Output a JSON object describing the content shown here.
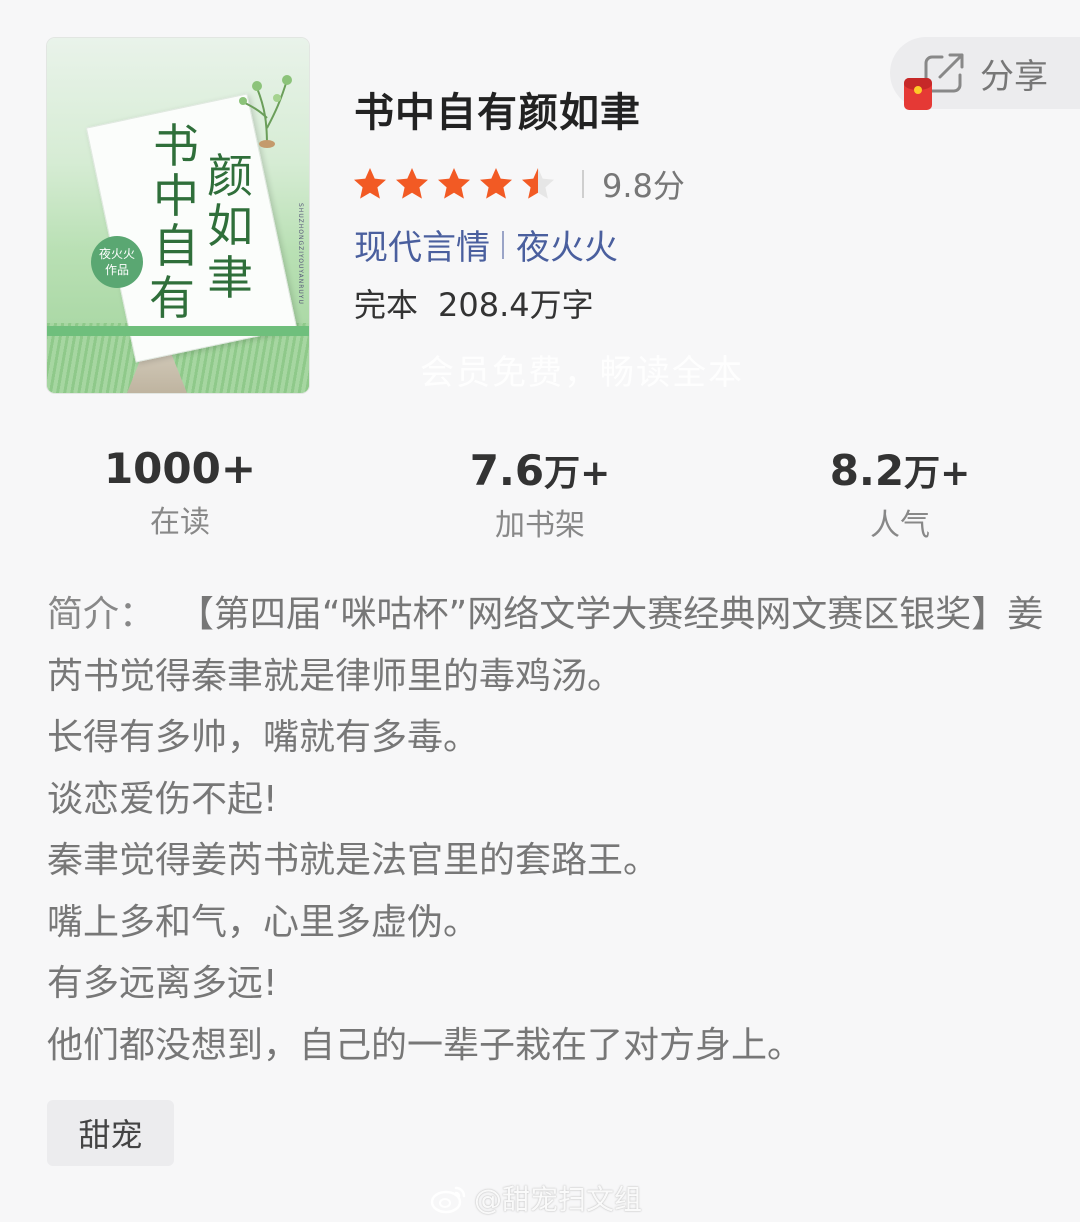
{
  "book": {
    "title": "书中自有颜如聿",
    "score": "9.8分",
    "rating": 4.5,
    "rating_max": 5,
    "genre": "现代言情",
    "author": "夜火火",
    "status": "完本",
    "word_count": "208.4万字",
    "overlay_text": "会员免费，畅读全本"
  },
  "cover": {
    "title_chars": [
      "书",
      "中",
      "自",
      "有",
      "颜",
      "如",
      "聿"
    ],
    "seal_line1": "夜火火",
    "seal_line2": "作品",
    "pinyin": "SHUZHONGZIYOUYANRUYU"
  },
  "share": {
    "label": "分享"
  },
  "stats": [
    {
      "value": "1000+",
      "unit": "",
      "label": "在读"
    },
    {
      "value": "7.6",
      "unit": "万+",
      "label": "加书架"
    },
    {
      "value": "8.2",
      "unit": "万+",
      "label": "人气"
    }
  ],
  "intro": {
    "label": "简介：",
    "lines": [
      "【第四届“咪咕杯”网络文学大赛经典网文赛区银奖】姜芮书觉得秦聿就是律师里的毒鸡汤。",
      "长得有多帅，嘴就有多毒。",
      "谈恋爱伤不起!",
      "秦聿觉得姜芮书就是法官里的套路王。",
      "嘴上多和气，心里多虚伪。",
      "有多远离多远!",
      "他们都没想到，自己的一辈子栽在了对方身上。"
    ]
  },
  "tag": "甜宠",
  "watermark": "@甜宠扫文组",
  "colors": {
    "star": "#f25a24",
    "star_empty": "#e6e6e6",
    "link": "#4a5f9e"
  }
}
